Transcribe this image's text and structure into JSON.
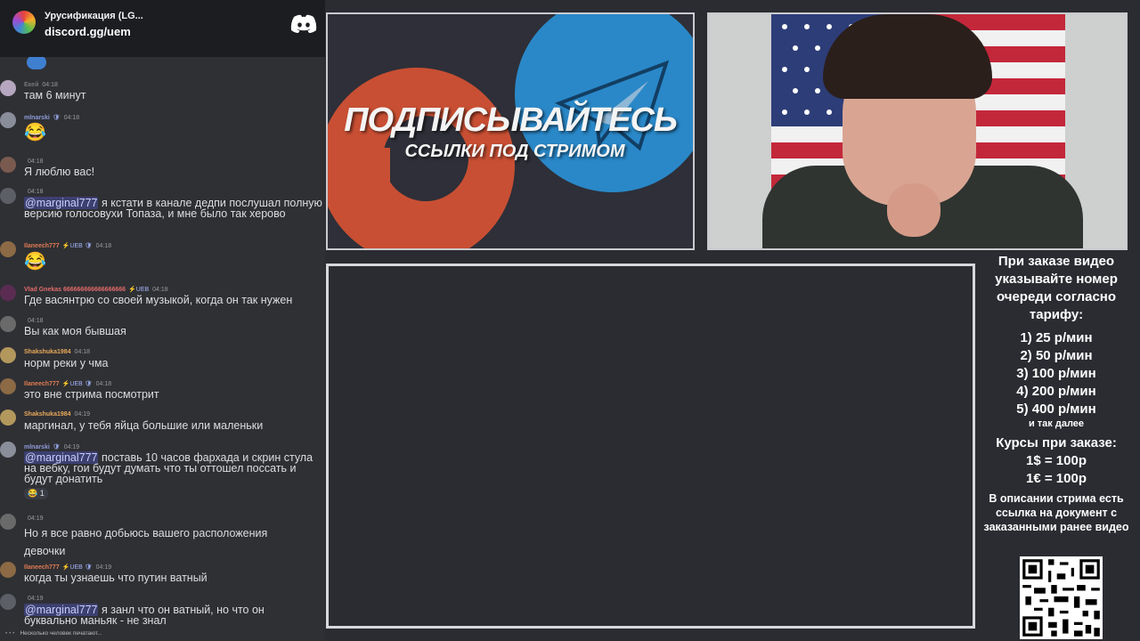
{
  "chat": {
    "server_name": "Урусификация (LG...",
    "invite": "discord.gg/uem",
    "typing": "Несколько человек печатают...",
    "messages": [
      {
        "user": "",
        "badges": "",
        "time": "",
        "text": "",
        "emoji": "",
        "avatar_color": "#3f7fd0"
      },
      {
        "user": "Екей",
        "badges": "",
        "time": "04:18",
        "text": "там 6 минут",
        "avatar_color": "#b7a6c0"
      },
      {
        "user": "mlnarski",
        "badges": "🛡",
        "time": "04:18",
        "text": "",
        "emoji": "😂",
        "avatar_color": "#8a8e9a"
      },
      {
        "user": "",
        "badges": "",
        "time": "04:18",
        "text": "Я люблю вас!",
        "avatar_color": "#7a5a4f"
      },
      {
        "user": "",
        "badges": "",
        "time": "04:18",
        "mention": "@marginal777",
        "text": "я кстати в канале дедпи послушал полную версию голосовухи Топаза, и мне было так херово",
        "avatar_color": "#5d5f66"
      },
      {
        "user": "Ilaneech777",
        "badges": "⚡UEB 🛡",
        "time": "04:18",
        "text": "",
        "emoji": "😂",
        "avatar_color": "#8c6a45"
      },
      {
        "user": "Vlad Gnekas 666666666666666666",
        "badges": "⚡UEB",
        "time": "04:18",
        "text": "Где васянтрю со своей музыкой, когда он так нужен",
        "avatar_color": "#5a2c52"
      },
      {
        "user": "",
        "badges": "",
        "time": "04:18",
        "text": "Вы как моя бывшая",
        "avatar_color": "#6a6a6a"
      },
      {
        "user": "Shakshuka1984",
        "badges": "",
        "time": "04:18",
        "text": "норм реки у чма",
        "avatar_color": "#b3985d"
      },
      {
        "user": "Ilaneech777",
        "badges": "⚡UEB 🛡",
        "time": "04:18",
        "text": "это вне стрима посмотрит",
        "avatar_color": "#8c6a45"
      },
      {
        "user": "Shakshuka1984",
        "badges": "",
        "time": "04:19",
        "text": "маргинал, у тебя яйца большие или маленьки",
        "avatar_color": "#b3985d"
      },
      {
        "user": "mlnarski",
        "badges": "🛡",
        "time": "04:19",
        "mention": "@marginal777",
        "text": "поставь 10 часов фархада и скрин стула на вебку, гои будут думать что ты оттошел поссать и будут донатить",
        "reaction": "😂 1",
        "avatar_color": "#8a8e9a"
      },
      {
        "user": "",
        "badges": "",
        "time": "04:19",
        "text": "Но я все равно добьюсь вашего расположения девочки",
        "avatar_color": "#6a6a6a"
      },
      {
        "user": "Ilaneech777",
        "badges": "⚡UEB 🛡",
        "time": "04:19",
        "text": "когда ты узнаешь что путин ватный",
        "avatar_color": "#8c6a45"
      },
      {
        "user": "",
        "badges": "",
        "time": "04:19",
        "mention": "@marginal777",
        "text": "я занл что он ватный, но что он буквально маньяк - не знал",
        "avatar_color": "#5d5f66"
      }
    ]
  },
  "promo": {
    "title": "ПОДПИСЫВАЙТЕСЬ",
    "subtitle": "ССЫЛКИ ПОД СТРИМОМ"
  },
  "info": {
    "heading": "При заказе видео указывайте номер очереди согласно тарифу:",
    "tariffs": [
      "1) 25 р/мин",
      "2) 50 р/мин",
      "3) 100 р/мин",
      "4) 200 р/мин",
      "5) 400 р/мин"
    ],
    "etc": "и так далее",
    "rates_title": "Курсы при заказе:",
    "rates": [
      "1$ = 100р",
      "1€ = 100р"
    ],
    "note": "В описании стрима есть ссылка на документ с заказанными ранее видео"
  },
  "colors": {
    "accent_orange": "#c84f33",
    "accent_blue": "#2a88c8",
    "chat_bg": "#2f3034",
    "header_bg": "#1c1d21"
  }
}
